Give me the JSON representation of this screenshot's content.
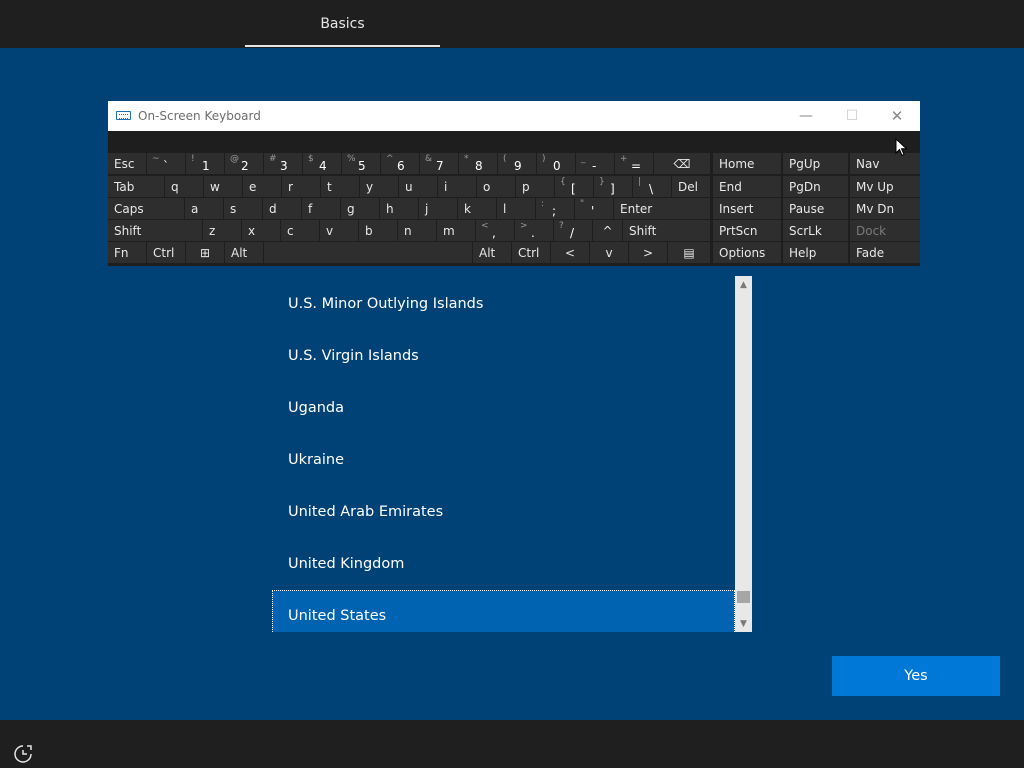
{
  "header": {
    "tab_label": "Basics"
  },
  "osk": {
    "title": "On-Screen Keyboard",
    "controls": {
      "minimize": "—",
      "maximize": "☐",
      "close": "✕"
    },
    "rows": [
      [
        {
          "id": "esc",
          "label": "Esc"
        },
        {
          "id": "tilde",
          "shift": "~",
          "main": "`"
        },
        {
          "id": "1",
          "shift": "!",
          "main": "1"
        },
        {
          "id": "2",
          "shift": "@",
          "main": "2"
        },
        {
          "id": "3",
          "shift": "#",
          "main": "3"
        },
        {
          "id": "4",
          "shift": "$",
          "main": "4"
        },
        {
          "id": "5",
          "shift": "%",
          "main": "5"
        },
        {
          "id": "6",
          "shift": "^",
          "main": "6"
        },
        {
          "id": "7",
          "shift": "&",
          "main": "7"
        },
        {
          "id": "8",
          "shift": "*",
          "main": "8"
        },
        {
          "id": "9",
          "shift": "(",
          "main": "9"
        },
        {
          "id": "0",
          "shift": ")",
          "main": "0"
        },
        {
          "id": "minus",
          "shift": "_",
          "main": "-"
        },
        {
          "id": "equals",
          "shift": "+",
          "main": "="
        },
        {
          "id": "backspace",
          "label": "⌫"
        }
      ],
      [
        {
          "id": "tab",
          "label": "Tab"
        },
        {
          "id": "q",
          "label": "q"
        },
        {
          "id": "w",
          "label": "w"
        },
        {
          "id": "e",
          "label": "e"
        },
        {
          "id": "r",
          "label": "r"
        },
        {
          "id": "t",
          "label": "t"
        },
        {
          "id": "y",
          "label": "y"
        },
        {
          "id": "u",
          "label": "u"
        },
        {
          "id": "i",
          "label": "i"
        },
        {
          "id": "o",
          "label": "o"
        },
        {
          "id": "p",
          "label": "p"
        },
        {
          "id": "lbracket",
          "shift": "{",
          "main": "["
        },
        {
          "id": "rbracket",
          "shift": "}",
          "main": "]"
        },
        {
          "id": "backslash",
          "shift": "|",
          "main": "\\"
        },
        {
          "id": "del",
          "label": "Del"
        }
      ],
      [
        {
          "id": "caps",
          "label": "Caps"
        },
        {
          "id": "a",
          "label": "a"
        },
        {
          "id": "s",
          "label": "s"
        },
        {
          "id": "d",
          "label": "d"
        },
        {
          "id": "f",
          "label": "f"
        },
        {
          "id": "g",
          "label": "g"
        },
        {
          "id": "h",
          "label": "h"
        },
        {
          "id": "j",
          "label": "j"
        },
        {
          "id": "k",
          "label": "k"
        },
        {
          "id": "l",
          "label": "l"
        },
        {
          "id": "semicolon",
          "shift": ":",
          "main": ";"
        },
        {
          "id": "quote",
          "shift": "\"",
          "main": "'"
        },
        {
          "id": "enter",
          "label": "Enter"
        }
      ],
      [
        {
          "id": "lshift",
          "label": "Shift"
        },
        {
          "id": "z",
          "label": "z"
        },
        {
          "id": "x",
          "label": "x"
        },
        {
          "id": "c",
          "label": "c"
        },
        {
          "id": "v",
          "label": "v"
        },
        {
          "id": "b",
          "label": "b"
        },
        {
          "id": "n",
          "label": "n"
        },
        {
          "id": "m",
          "label": "m"
        },
        {
          "id": "comma",
          "shift": "<",
          "main": ","
        },
        {
          "id": "period",
          "shift": ">",
          "main": "."
        },
        {
          "id": "slash",
          "shift": "?",
          "main": "/"
        },
        {
          "id": "up",
          "label": "^"
        },
        {
          "id": "rshift",
          "label": "Shift"
        }
      ],
      [
        {
          "id": "fn",
          "label": "Fn"
        },
        {
          "id": "lctrl",
          "label": "Ctrl"
        },
        {
          "id": "win",
          "label": "⊞"
        },
        {
          "id": "lalt",
          "label": "Alt"
        },
        {
          "id": "space",
          "label": ""
        },
        {
          "id": "ralt",
          "label": "Alt"
        },
        {
          "id": "rctrl",
          "label": "Ctrl"
        },
        {
          "id": "left",
          "label": "<"
        },
        {
          "id": "down",
          "label": "v"
        },
        {
          "id": "right",
          "label": ">"
        },
        {
          "id": "menu",
          "label": "▤"
        }
      ]
    ],
    "nav_cols": [
      [
        "Home",
        "End",
        "Insert",
        "PrtScn",
        "Options"
      ],
      [
        "PgUp",
        "PgDn",
        "Pause",
        "ScrLk",
        "Help"
      ],
      [
        "Nav",
        "Mv Up",
        "Mv Dn",
        "Dock",
        "Fade"
      ]
    ]
  },
  "list": {
    "items": [
      "U.S. Minor Outlying Islands",
      "U.S. Virgin Islands",
      "Uganda",
      "Ukraine",
      "United Arab Emirates",
      "United Kingdom",
      "United States"
    ],
    "selected_index": 6
  },
  "yes_label": "Yes"
}
